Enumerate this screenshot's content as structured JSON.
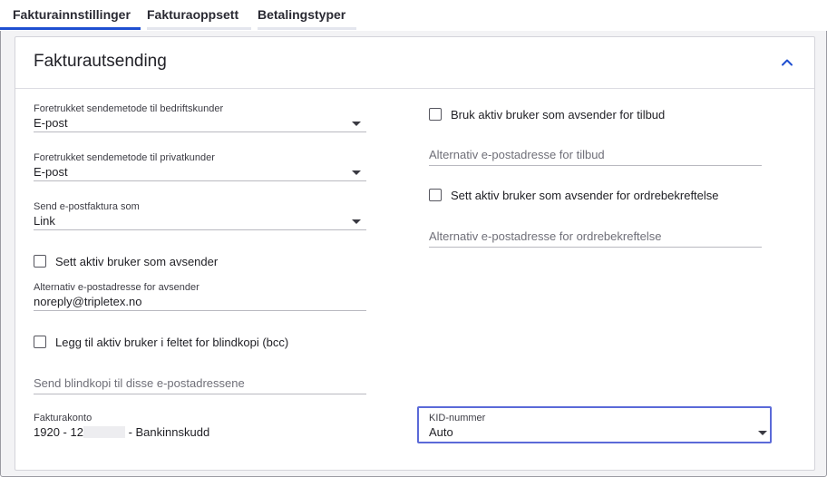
{
  "tabs": [
    {
      "label": "Fakturainnstillinger",
      "active": true
    },
    {
      "label": "Fakturaoppsett",
      "active": false
    },
    {
      "label": "Betalingstyper",
      "active": false
    }
  ],
  "section": {
    "title": "Fakturautsending",
    "collapse_icon": "chevron-up-icon"
  },
  "left": {
    "business_method": {
      "label": "Foretrukket sendemetode til bedriftskunder",
      "value": "E-post"
    },
    "private_method": {
      "label": "Foretrukket sendemetode til privatkunder",
      "value": "E-post"
    },
    "email_invoice_as": {
      "label": "Send e-postfaktura som",
      "value": "Link"
    },
    "active_user_sender": {
      "label": "Sett aktiv bruker som avsender",
      "checked": false
    },
    "alt_sender_email": {
      "label": "Alternativ e-postadresse for avsender",
      "value": "noreply@tripletex.no"
    },
    "bcc_active_user": {
      "label": "Legg til aktiv bruker i feltet for blindkopi (bcc)",
      "checked": false
    },
    "bcc_addresses": {
      "placeholder": "Send blindkopi til disse e-postadressene"
    },
    "invoice_account": {
      "label": "Fakturakonto",
      "value_start": "1920 - 12",
      "value_end": "- Bankinnskudd"
    }
  },
  "right": {
    "quote_active_sender": {
      "label": "Bruk aktiv bruker som avsender for tilbud",
      "checked": false
    },
    "quote_alt_email": {
      "placeholder": "Alternativ e-postadresse for tilbud"
    },
    "order_active_sender": {
      "label": "Sett aktiv bruker som avsender for ordrebekreftelse",
      "checked": false
    },
    "order_alt_email": {
      "placeholder": "Alternativ e-postadresse for ordrebekreftelse"
    },
    "kid": {
      "label": "KID-nummer",
      "value": "Auto"
    }
  },
  "colors": {
    "accent": "#1f4fd1",
    "highlight": "#5b6ad8"
  }
}
